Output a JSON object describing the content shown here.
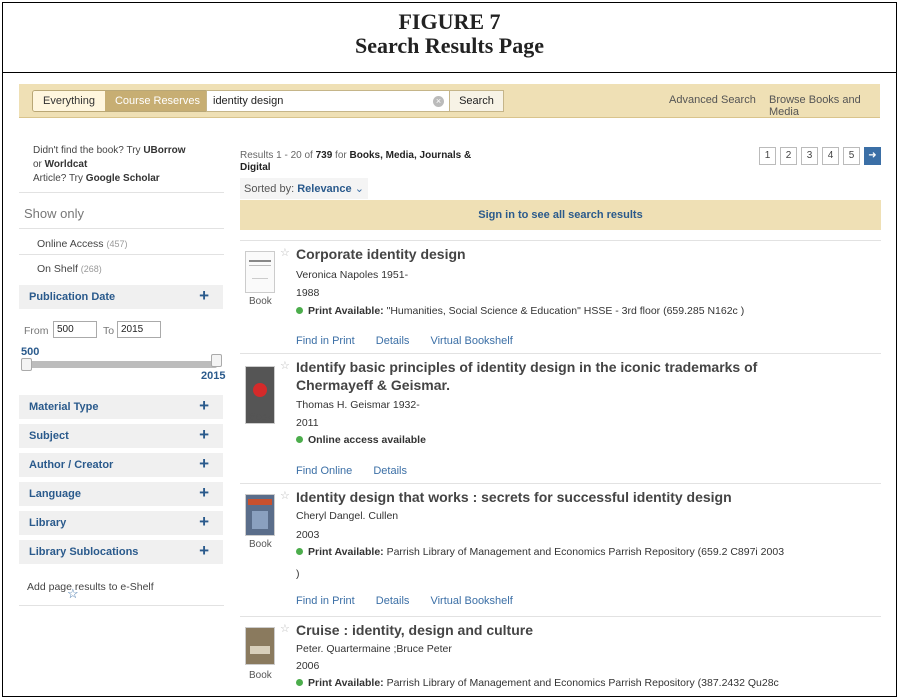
{
  "figure": {
    "title": "FIGURE 7",
    "subtitle": "Search Results Page"
  },
  "topbar": {
    "scope_everything": "Everything",
    "scope_course": "Course Reserves",
    "search_value": "identity design",
    "search_button": "Search",
    "advanced": "Advanced Search",
    "browse": "Browse Books and Media"
  },
  "sidebar": {
    "help": {
      "t1": "Didn't find the book? Try ",
      "uborrow": "UBorrow",
      "t2": " or ",
      "worldcat": "Worldcat",
      "t3": "Article? Try ",
      "scholar": "Google Scholar"
    },
    "show_only": "Show only",
    "online_access": "Online Access",
    "online_count": "(457)",
    "on_shelf": "On Shelf",
    "shelf_count": "(268)",
    "pub_date": "Publication Date",
    "from_label": "From",
    "from_value": "500",
    "to_label": "To",
    "to_value": "2015",
    "range_min": "500",
    "range_max": "2015",
    "facets": [
      "Material Type",
      "Subject",
      "Author / Creator",
      "Language",
      "Library",
      "Library Sublocations"
    ],
    "add_shelf": "Add page results to e-Shelf"
  },
  "results": {
    "count_prefix": "Results 1 - 20 of ",
    "count": "739",
    "count_mid": " for ",
    "count_scope": "Books, Media, Journals & Digital",
    "pages": [
      "1",
      "2",
      "3",
      "4",
      "5"
    ],
    "sorted_label": "Sorted by: ",
    "sorted_value": "Relevance",
    "signin": "Sign in to see all search results",
    "type": "Book",
    "records": [
      {
        "title": "Corporate identity design",
        "author": "Veronica Napoles 1951-",
        "year": "1988",
        "status": "Print Available:",
        "location": "\"Humanities, Social Science & Education\" HSSE - 3rd floor (659.285 N162c )",
        "links": [
          "Find in Print",
          "Details",
          "Virtual Bookshelf"
        ]
      },
      {
        "title": "Identify basic principles of identity design in the iconic trademarks of Chermayeff & Geismar.",
        "author": "Thomas H. Geismar 1932-",
        "year": "2011",
        "status": "Online access available",
        "location": "",
        "links": [
          "Find Online",
          "Details"
        ]
      },
      {
        "title": "Identity design that works : secrets for successful identity design",
        "author": "Cheryl Dangel. Cullen",
        "year": "2003",
        "status": "Print Available:",
        "location": "Parrish Library of Management and Economics Parrish Repository (659.2 C897i 2003",
        "location2": ")",
        "links": [
          "Find in Print",
          "Details",
          "Virtual Bookshelf"
        ]
      },
      {
        "title": "Cruise : identity, design and culture",
        "author": "Peter. Quartermaine ;Bruce Peter",
        "year": "2006",
        "status": "Print Available:",
        "location": "Parrish Library of Management and Economics Parrish Repository (387.2432 Qu28c",
        "links": []
      }
    ]
  },
  "colors": {
    "tan": "#efe0b5",
    "link": "#3b6fa6",
    "green": "#4cad4c"
  }
}
